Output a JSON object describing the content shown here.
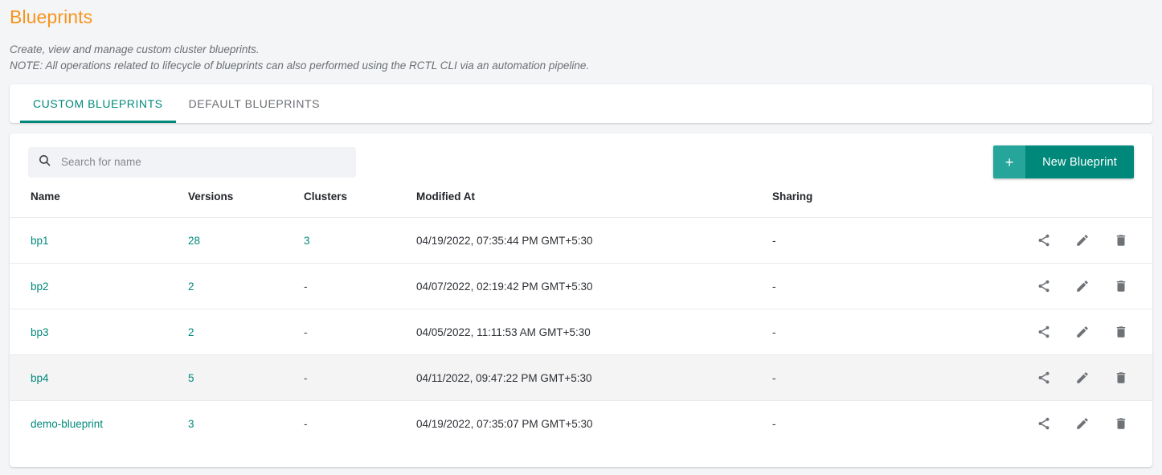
{
  "header": {
    "title": "Blueprints",
    "description_line1": "Create, view and manage custom cluster blueprints.",
    "description_line2": "NOTE: All operations related to lifecycle of blueprints can also performed using the RCTL CLI via an automation pipeline."
  },
  "tabs": [
    {
      "label": "CUSTOM BLUEPRINTS",
      "active": true
    },
    {
      "label": "DEFAULT BLUEPRINTS",
      "active": false
    }
  ],
  "toolbar": {
    "search_placeholder": "Search for name",
    "search_value": "",
    "search_icon": "search-icon",
    "new_button_plus": "+",
    "new_button_label": "New Blueprint"
  },
  "table": {
    "columns": [
      "Name",
      "Versions",
      "Clusters",
      "Modified At",
      "Sharing"
    ],
    "row_actions": [
      "share-icon",
      "edit-icon",
      "delete-icon"
    ],
    "rows": [
      {
        "name": "bp1",
        "versions": "28",
        "clusters": "3",
        "modified_at": "04/19/2022, 07:35:44 PM GMT+5:30",
        "sharing": "-",
        "hovered": false
      },
      {
        "name": "bp2",
        "versions": "2",
        "clusters": "-",
        "modified_at": "04/07/2022, 02:19:42 PM GMT+5:30",
        "sharing": "-",
        "hovered": false
      },
      {
        "name": "bp3",
        "versions": "2",
        "clusters": "-",
        "modified_at": "04/05/2022, 11:11:53 AM GMT+5:30",
        "sharing": "-",
        "hovered": false
      },
      {
        "name": "bp4",
        "versions": "5",
        "clusters": "-",
        "modified_at": "04/11/2022, 09:47:22 PM GMT+5:30",
        "sharing": "-",
        "hovered": true
      },
      {
        "name": "demo-blueprint",
        "versions": "3",
        "clusters": "-",
        "modified_at": "04/19/2022, 07:35:07 PM GMT+5:30",
        "sharing": "-",
        "hovered": false
      }
    ]
  },
  "colors": {
    "title": "#f7941e",
    "accent": "#00897b",
    "accent_light": "#26a69a",
    "page_background": "#f4f5f7",
    "card_background": "#ffffff",
    "row_hover": "#f4f4f5"
  }
}
